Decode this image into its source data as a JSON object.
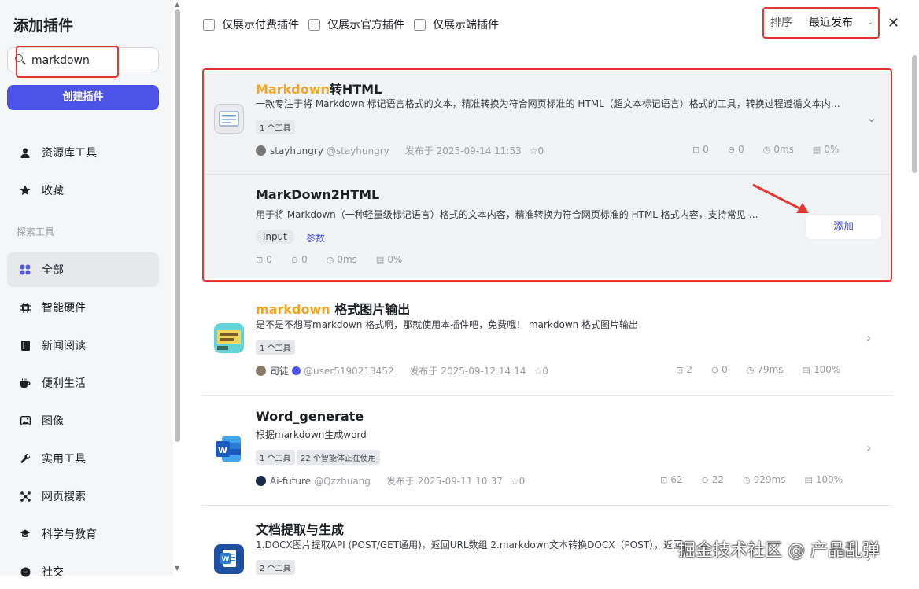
{
  "sidebar": {
    "title": "添加插件",
    "search_value": "markdown",
    "create_label": "创建插件",
    "items_top": [
      {
        "label": "资源库工具",
        "icon": "person-icon"
      },
      {
        "label": "收藏",
        "icon": "star-icon"
      }
    ],
    "section_label": "探索工具",
    "items": [
      {
        "label": "全部",
        "icon": "grid-icon",
        "active": true
      },
      {
        "label": "智能硬件",
        "icon": "chip-icon"
      },
      {
        "label": "新闻阅读",
        "icon": "book-icon"
      },
      {
        "label": "便利生活",
        "icon": "coffee-icon"
      },
      {
        "label": "图像",
        "icon": "image-icon"
      },
      {
        "label": "实用工具",
        "icon": "wrench-icon"
      },
      {
        "label": "网页搜索",
        "icon": "network-icon"
      },
      {
        "label": "科学与教育",
        "icon": "graduation-cap-icon"
      },
      {
        "label": "社交",
        "icon": "chat-icon"
      }
    ]
  },
  "header": {
    "filters": [
      "仅展示付费插件",
      "仅展示官方插件",
      "仅展示端插件"
    ],
    "sort_label": "排序",
    "sort_value": "最近发布",
    "close": "✕"
  },
  "plugins": [
    {
      "title_kw": "Markdown",
      "title_rest": "转HTML",
      "desc": "一款专注于将 Markdown 标记语言格式的文本，精准转换为符合网页标准的 HTML（超文本标记语言）格式的工具，转换过程遵循文本内…",
      "tags": [
        "1 个工具"
      ],
      "author": "stayhungry",
      "handle": "@stayhungry",
      "published": "发布于 2025-09-14 11:53",
      "stars": "0",
      "stats": [
        "0",
        "0",
        "0ms",
        "0%"
      ],
      "tool": {
        "name": "MarkDown2HTML",
        "desc": "用于将 Markdown（一种轻量级标记语言）格式的文本内容，精准转换为符合网页标准的 HTML 格式内容，支持常见 M…",
        "param_tag": "input",
        "param_label": "参数",
        "stats": [
          "0",
          "0",
          "0ms",
          "0%"
        ],
        "add_label": "添加"
      }
    },
    {
      "title_kw": "markdown",
      "title_rest": " 格式图片输出",
      "desc": "是不是不想写markdown 格式啊，那就使用本插件吧，免费哦！ markdown 格式图片输出",
      "tags": [
        "1 个工具"
      ],
      "author": "司徒",
      "handle": "@user5190213452",
      "published": "发布于 2025-09-12 14:14",
      "stars": "0",
      "stats": [
        "2",
        "0",
        "79ms",
        "100%"
      ]
    },
    {
      "title_kw": "",
      "title_rest": "Word_generate",
      "desc": "根据markdown生成word",
      "tags": [
        "1 个工具",
        "22 个智能体正在使用"
      ],
      "author": "Ai-future",
      "handle": "@Qzzhuang",
      "published": "发布于 2025-09-11 10:37",
      "stars": "0",
      "stats": [
        "62",
        "22",
        "929ms",
        "100%"
      ]
    },
    {
      "title_kw": "",
      "title_rest": "文档提取与生成",
      "desc": "1.DOCX图片提取API (POST/GET通用)，返回URL数组 2.markdown文本转换DOCX（POST），返回下载地址",
      "tags": [
        "2 个工具"
      ]
    }
  ],
  "watermark": "掘金技术社区 @ 产品乱弹",
  "colors": {
    "accent": "#4d53e8",
    "keyword": "#f5a524",
    "highlight": "#e3372f"
  }
}
